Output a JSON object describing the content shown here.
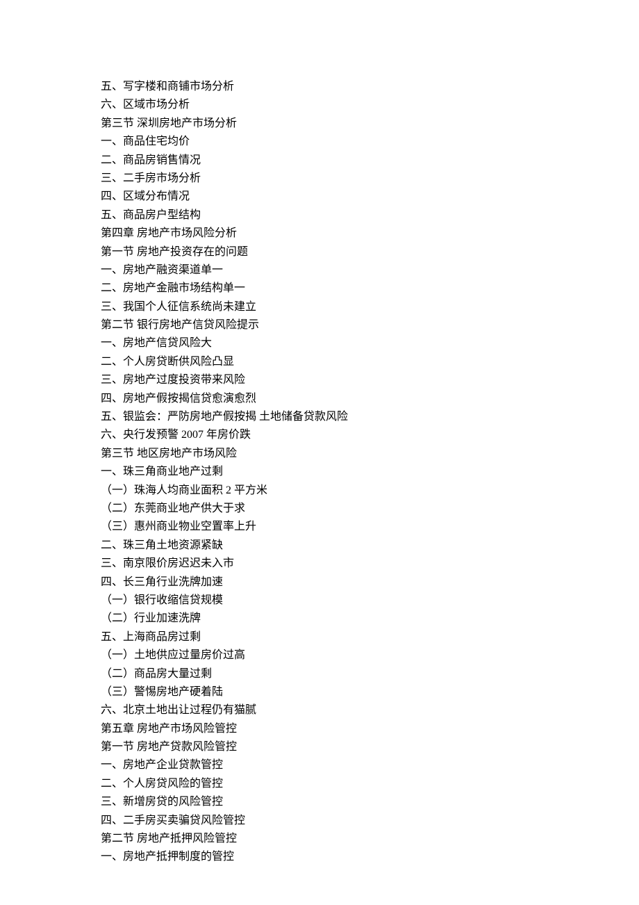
{
  "lines": [
    "五、写字楼和商铺市场分析",
    "六、区域市场分析",
    "第三节  深圳房地产市场分析",
    "一、商品住宅均价",
    "二、商品房销售情况",
    "三、二手房市场分析",
    "四、区域分布情况",
    "五、商品房户型结构",
    "第四章  房地产市场风险分析",
    "第一节  房地产投资存在的问题",
    "一、房地产融资渠道单一",
    "二、房地产金融市场结构单一",
    "三、我国个人征信系统尚未建立",
    "第二节  银行房地产信贷风险提示",
    "一、房地产信贷风险大",
    "二、个人房贷断供风险凸显",
    "三、房地产过度投资带来风险",
    "四、房地产假按揭信贷愈演愈烈",
    "五、银监会：严防房地产假按揭  土地储备贷款风险",
    "六、央行发预警    2007 年房价跌",
    "第三节  地区房地产市场风险",
    "一、珠三角商业地产过剩",
    "（一）珠海人均商业面积 2 平方米",
    "（二）东莞商业地产供大于求",
    "（三）惠州商业物业空置率上升",
    "二、珠三角土地资源紧缺",
    "三、南京限价房迟迟未入市",
    "四、长三角行业洗牌加速",
    "（一）银行收缩信贷规模",
    "（二）行业加速洗牌",
    "五、上海商品房过剩",
    "（一）土地供应过量房价过高",
    "（二）商品房大量过剩",
    "（三）警惕房地产硬着陆",
    "六、北京土地出让过程仍有猫腻",
    "第五章  房地产市场风险管控",
    "第一节  房地产贷款风险管控",
    "一、房地产企业贷款管控",
    "二、个人房贷风险的管控",
    "三、新增房贷的风险管控",
    "四、二手房买卖骗贷风险管控",
    "第二节  房地产抵押风险管控",
    "一、房地产抵押制度的管控"
  ]
}
